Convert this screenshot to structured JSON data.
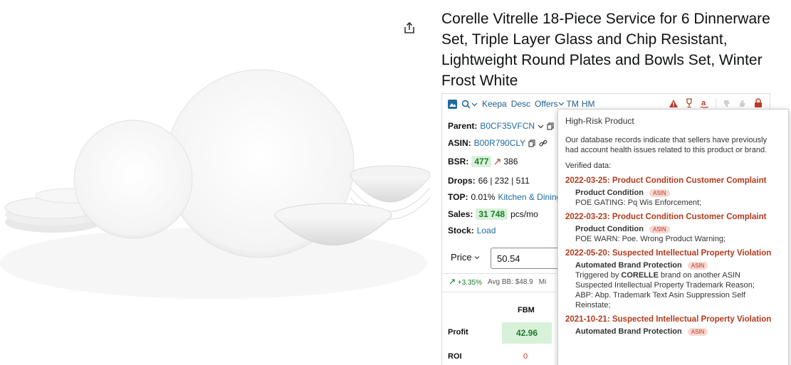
{
  "product": {
    "title": "Corelle Vitrelle 18-Piece Service for 6 Dinnerware Set, Triple Layer Glass and Chip Resistant, Lightweight Round Plates and Bowls Set, Winter Frost White",
    "share_icon": "share-icon",
    "image_icon": "dinnerware-set-image"
  },
  "toolbar": {
    "keepa_label": "Keepa",
    "desc_label": "Desc",
    "offers_label": "Offers",
    "tm_label": "TM",
    "hm_label": "HM",
    "icons": [
      "mountain-icon",
      "search-icon",
      "warning-icon",
      "trophy-icon",
      "amazon-icon",
      "thumbs-down-icon",
      "thumbs-up-icon",
      "lock-icon"
    ]
  },
  "info": {
    "parent_label": "Parent:",
    "parent_value": "B0CF35VFCN",
    "asin_label": "ASIN:",
    "asin_value": "B00R790CLY",
    "bsr_label": "BSR:",
    "bsr_value": "477",
    "bsr_trend": "386",
    "drops_label": "Drops:",
    "drops_value": "66 | 232 | 511",
    "top_label": "TOP:",
    "top_value": "0.01%",
    "top_category": "Kitchen & Dining",
    "sales_label": "Sales:",
    "sales_value": "31 748",
    "sales_unit": "pcs/mo",
    "stock_label": "Stock:",
    "stock_value": "Load"
  },
  "price": {
    "label": "Price",
    "value": "50.54",
    "trend": "+3.35%",
    "avg_bb": "Avg BB: $48.9",
    "extra": "Mi"
  },
  "calc": {
    "fbm_label": "FBM",
    "profit_label": "Profit",
    "profit_value": "42.96",
    "roi_label": "ROI",
    "roi_value": "0"
  },
  "popover": {
    "title": "High-Risk Product",
    "description": "Our database records indicate that sellers have previously had account health issues related to this product or brand.",
    "verified_label": "Verified data:",
    "entries": [
      {
        "title": "2022-03-25: Product Condition Customer Complaint",
        "category": "Product Condition",
        "badge": "ASIN",
        "lines": [
          "POE GATING: Pq Wis Enforcement;"
        ]
      },
      {
        "title": "2022-03-23: Product Condition Customer Complaint",
        "category": "Product Condition",
        "badge": "ASIN",
        "lines": [
          "POE WARN: Poe. Wrong Product Warning;"
        ]
      },
      {
        "title": "2022-05-20: Suspected Intellectual Property Violation",
        "category": "Automated Brand Protection",
        "badge": "ASIN",
        "trigger_prefix": "Triggered by",
        "trigger_brand": "CORELLE",
        "trigger_suffix": "brand on another ASIN",
        "lines": [
          "Suspected Intellectual Property Trademark Reason;",
          "ABP: Abp. Trademark Text Asin Suppression Self Reinstate;"
        ]
      },
      {
        "title": "2021-10-21: Suspected Intellectual Property Violation",
        "category": "Automated Brand Protection",
        "badge": "ASIN"
      }
    ]
  }
}
